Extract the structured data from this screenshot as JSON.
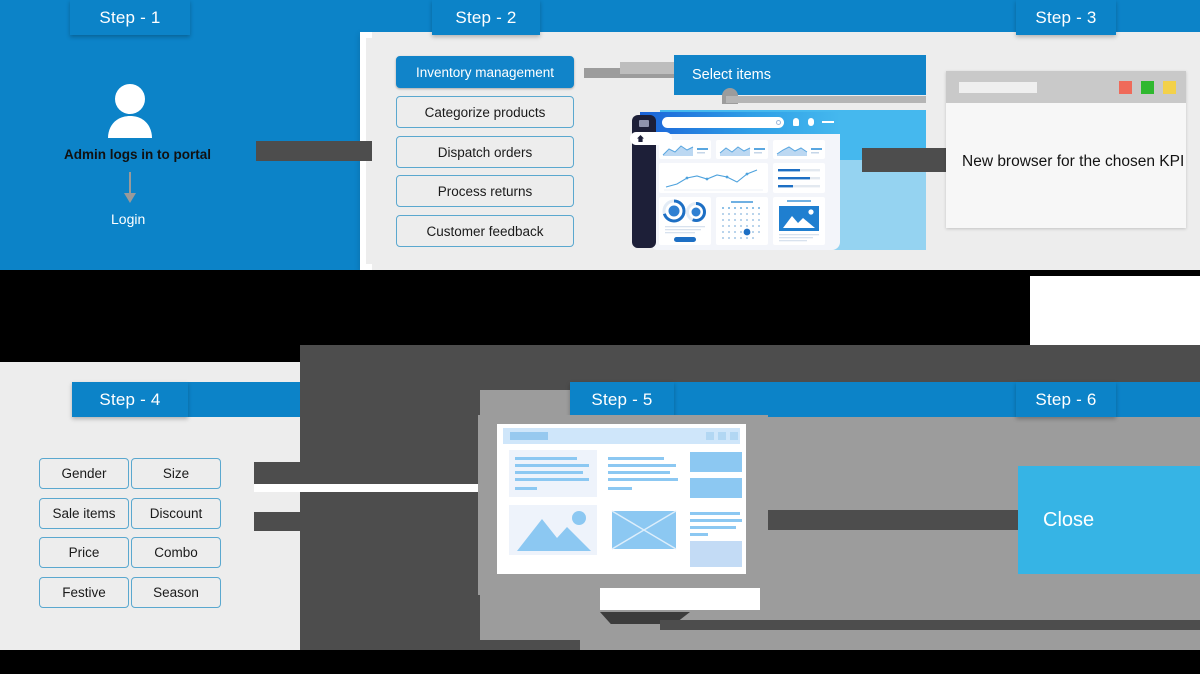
{
  "meta": {
    "accent_blue": "#0c83c8",
    "accent_light_blue": "#36b4e5",
    "panel_light": "#ededed",
    "panel_gray": "#9c9c9c",
    "connector_dark": "#4d4d4d"
  },
  "steps": [
    {
      "id": "step-1",
      "label": "Step - 1"
    },
    {
      "id": "step-2",
      "label": "Step - 2"
    },
    {
      "id": "step-3",
      "label": "Step - 3"
    },
    {
      "id": "step-4",
      "label": "Step - 4"
    },
    {
      "id": "step-5",
      "label": "Step - 5"
    },
    {
      "id": "step-6",
      "label": "Step - 6"
    }
  ],
  "step1": {
    "avatar_icon": "user-avatar-icon",
    "caption": "Admin logs in to portal",
    "arrow_icon": "arrow-down-icon",
    "login_label": "Login"
  },
  "step2": {
    "menu": [
      {
        "label": "Inventory management",
        "active": true
      },
      {
        "label": "Categorize products",
        "active": false
      },
      {
        "label": "Dispatch orders",
        "active": false
      },
      {
        "label": "Process returns",
        "active": false
      },
      {
        "label": "Customer feedback",
        "active": false
      }
    ],
    "banner_label": "Select items",
    "dashboard": {
      "name": "analytics-dashboard-illustration",
      "sidebar_icons": [
        "menu-icon",
        "home-icon",
        "user-icon",
        "location-icon",
        "chat-icon",
        "star-icon",
        "gear-icon",
        "lock-icon"
      ],
      "topbar_icons": [
        "search-icon",
        "bell-icon",
        "profile-icon",
        "more-icon"
      ]
    }
  },
  "step3": {
    "browser": {
      "url_placeholder": "",
      "dots": [
        "#ef6a5a",
        "#2fb82f",
        "#f3d14a"
      ],
      "body_text": "New browser for the chosen KPI"
    }
  },
  "step4": {
    "filters": [
      [
        "Gender",
        "Size"
      ],
      [
        "Sale items",
        "Discount"
      ],
      [
        "Price",
        "Combo"
      ],
      [
        "Festive",
        "Season"
      ]
    ]
  },
  "step5": {
    "monitor_name": "desktop-monitor-illustration",
    "wireframe_icons": [
      "image-placeholder-icon",
      "photo-cross-icon"
    ]
  },
  "step6": {
    "close_label": "Close"
  }
}
